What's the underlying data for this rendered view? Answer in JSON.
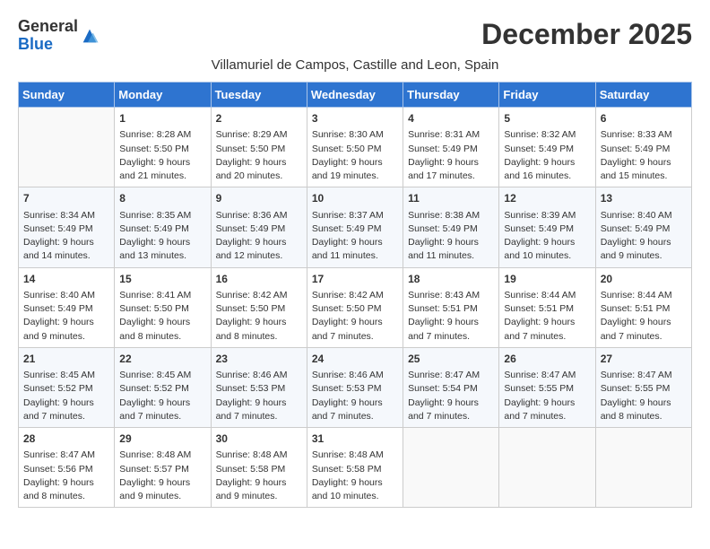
{
  "logo": {
    "general": "General",
    "blue": "Blue"
  },
  "title": "December 2025",
  "subtitle": "Villamuriel de Campos, Castille and Leon, Spain",
  "days_of_week": [
    "Sunday",
    "Monday",
    "Tuesday",
    "Wednesday",
    "Thursday",
    "Friday",
    "Saturday"
  ],
  "weeks": [
    [
      {
        "day": "",
        "info": ""
      },
      {
        "day": "1",
        "info": "Sunrise: 8:28 AM\nSunset: 5:50 PM\nDaylight: 9 hours\nand 21 minutes."
      },
      {
        "day": "2",
        "info": "Sunrise: 8:29 AM\nSunset: 5:50 PM\nDaylight: 9 hours\nand 20 minutes."
      },
      {
        "day": "3",
        "info": "Sunrise: 8:30 AM\nSunset: 5:50 PM\nDaylight: 9 hours\nand 19 minutes."
      },
      {
        "day": "4",
        "info": "Sunrise: 8:31 AM\nSunset: 5:49 PM\nDaylight: 9 hours\nand 17 minutes."
      },
      {
        "day": "5",
        "info": "Sunrise: 8:32 AM\nSunset: 5:49 PM\nDaylight: 9 hours\nand 16 minutes."
      },
      {
        "day": "6",
        "info": "Sunrise: 8:33 AM\nSunset: 5:49 PM\nDaylight: 9 hours\nand 15 minutes."
      }
    ],
    [
      {
        "day": "7",
        "info": "Sunrise: 8:34 AM\nSunset: 5:49 PM\nDaylight: 9 hours\nand 14 minutes."
      },
      {
        "day": "8",
        "info": "Sunrise: 8:35 AM\nSunset: 5:49 PM\nDaylight: 9 hours\nand 13 minutes."
      },
      {
        "day": "9",
        "info": "Sunrise: 8:36 AM\nSunset: 5:49 PM\nDaylight: 9 hours\nand 12 minutes."
      },
      {
        "day": "10",
        "info": "Sunrise: 8:37 AM\nSunset: 5:49 PM\nDaylight: 9 hours\nand 11 minutes."
      },
      {
        "day": "11",
        "info": "Sunrise: 8:38 AM\nSunset: 5:49 PM\nDaylight: 9 hours\nand 11 minutes."
      },
      {
        "day": "12",
        "info": "Sunrise: 8:39 AM\nSunset: 5:49 PM\nDaylight: 9 hours\nand 10 minutes."
      },
      {
        "day": "13",
        "info": "Sunrise: 8:40 AM\nSunset: 5:49 PM\nDaylight: 9 hours\nand 9 minutes."
      }
    ],
    [
      {
        "day": "14",
        "info": "Sunrise: 8:40 AM\nSunset: 5:49 PM\nDaylight: 9 hours\nand 9 minutes."
      },
      {
        "day": "15",
        "info": "Sunrise: 8:41 AM\nSunset: 5:50 PM\nDaylight: 9 hours\nand 8 minutes."
      },
      {
        "day": "16",
        "info": "Sunrise: 8:42 AM\nSunset: 5:50 PM\nDaylight: 9 hours\nand 8 minutes."
      },
      {
        "day": "17",
        "info": "Sunrise: 8:42 AM\nSunset: 5:50 PM\nDaylight: 9 hours\nand 7 minutes."
      },
      {
        "day": "18",
        "info": "Sunrise: 8:43 AM\nSunset: 5:51 PM\nDaylight: 9 hours\nand 7 minutes."
      },
      {
        "day": "19",
        "info": "Sunrise: 8:44 AM\nSunset: 5:51 PM\nDaylight: 9 hours\nand 7 minutes."
      },
      {
        "day": "20",
        "info": "Sunrise: 8:44 AM\nSunset: 5:51 PM\nDaylight: 9 hours\nand 7 minutes."
      }
    ],
    [
      {
        "day": "21",
        "info": "Sunrise: 8:45 AM\nSunset: 5:52 PM\nDaylight: 9 hours\nand 7 minutes."
      },
      {
        "day": "22",
        "info": "Sunrise: 8:45 AM\nSunset: 5:52 PM\nDaylight: 9 hours\nand 7 minutes."
      },
      {
        "day": "23",
        "info": "Sunrise: 8:46 AM\nSunset: 5:53 PM\nDaylight: 9 hours\nand 7 minutes."
      },
      {
        "day": "24",
        "info": "Sunrise: 8:46 AM\nSunset: 5:53 PM\nDaylight: 9 hours\nand 7 minutes."
      },
      {
        "day": "25",
        "info": "Sunrise: 8:47 AM\nSunset: 5:54 PM\nDaylight: 9 hours\nand 7 minutes."
      },
      {
        "day": "26",
        "info": "Sunrise: 8:47 AM\nSunset: 5:55 PM\nDaylight: 9 hours\nand 7 minutes."
      },
      {
        "day": "27",
        "info": "Sunrise: 8:47 AM\nSunset: 5:55 PM\nDaylight: 9 hours\nand 8 minutes."
      }
    ],
    [
      {
        "day": "28",
        "info": "Sunrise: 8:47 AM\nSunset: 5:56 PM\nDaylight: 9 hours\nand 8 minutes."
      },
      {
        "day": "29",
        "info": "Sunrise: 8:48 AM\nSunset: 5:57 PM\nDaylight: 9 hours\nand 9 minutes."
      },
      {
        "day": "30",
        "info": "Sunrise: 8:48 AM\nSunset: 5:58 PM\nDaylight: 9 hours\nand 9 minutes."
      },
      {
        "day": "31",
        "info": "Sunrise: 8:48 AM\nSunset: 5:58 PM\nDaylight: 9 hours\nand 10 minutes."
      },
      {
        "day": "",
        "info": ""
      },
      {
        "day": "",
        "info": ""
      },
      {
        "day": "",
        "info": ""
      }
    ]
  ]
}
